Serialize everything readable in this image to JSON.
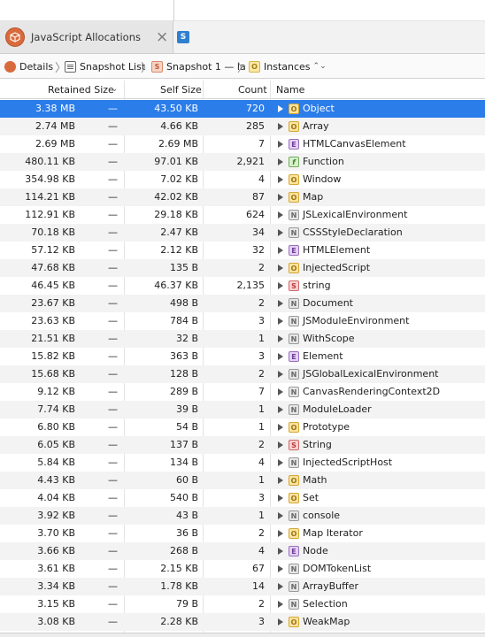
{
  "tab": {
    "title": "JavaScript Allocations",
    "close": "×",
    "secondary_badge": "S"
  },
  "breadcrumbs": [
    {
      "label": "Details"
    },
    {
      "label": "Snapshot List"
    },
    {
      "label": "Snapshot 1 — la",
      "badge": "S"
    },
    {
      "label": "Instances",
      "badge": "O",
      "chevron": "⌃⌄"
    }
  ],
  "columns": {
    "retained": "Retained Size",
    "self": "Self Size",
    "count": "Count",
    "name": "Name"
  },
  "rows": [
    {
      "retained": "3.38 MB",
      "self": "43.50 KB",
      "count": "720",
      "type": "O",
      "name": "Object",
      "selected": true
    },
    {
      "retained": "2.74 MB",
      "self": "4.66 KB",
      "count": "285",
      "type": "O",
      "name": "Array"
    },
    {
      "retained": "2.69 MB",
      "self": "2.69 MB",
      "count": "7",
      "type": "E",
      "name": "HTMLCanvasElement"
    },
    {
      "retained": "480.11 KB",
      "self": "97.01 KB",
      "count": "2,921",
      "type": "f",
      "name": "Function"
    },
    {
      "retained": "354.98 KB",
      "self": "7.02 KB",
      "count": "4",
      "type": "O",
      "name": "Window"
    },
    {
      "retained": "114.21 KB",
      "self": "42.02 KB",
      "count": "87",
      "type": "O",
      "name": "Map"
    },
    {
      "retained": "112.91 KB",
      "self": "29.18 KB",
      "count": "624",
      "type": "N",
      "name": "JSLexicalEnvironment"
    },
    {
      "retained": "70.18 KB",
      "self": "2.47 KB",
      "count": "34",
      "type": "N",
      "name": "CSSStyleDeclaration"
    },
    {
      "retained": "57.12 KB",
      "self": "2.12 KB",
      "count": "32",
      "type": "E",
      "name": "HTMLElement"
    },
    {
      "retained": "47.68 KB",
      "self": "135 B",
      "count": "2",
      "type": "O",
      "name": "InjectedScript"
    },
    {
      "retained": "46.45 KB",
      "self": "46.37 KB",
      "count": "2,135",
      "type": "S",
      "name": "string"
    },
    {
      "retained": "23.67 KB",
      "self": "498 B",
      "count": "2",
      "type": "N",
      "name": "Document"
    },
    {
      "retained": "23.63 KB",
      "self": "784 B",
      "count": "3",
      "type": "N",
      "name": "JSModuleEnvironment"
    },
    {
      "retained": "21.51 KB",
      "self": "32 B",
      "count": "1",
      "type": "N",
      "name": "WithScope"
    },
    {
      "retained": "15.82 KB",
      "self": "363 B",
      "count": "3",
      "type": "E",
      "name": "Element"
    },
    {
      "retained": "15.68 KB",
      "self": "128 B",
      "count": "2",
      "type": "N",
      "name": "JSGlobalLexicalEnvironment"
    },
    {
      "retained": "9.12 KB",
      "self": "289 B",
      "count": "7",
      "type": "N",
      "name": "CanvasRenderingContext2D"
    },
    {
      "retained": "7.74 KB",
      "self": "39 B",
      "count": "1",
      "type": "N",
      "name": "ModuleLoader"
    },
    {
      "retained": "6.80 KB",
      "self": "54 B",
      "count": "1",
      "type": "O",
      "name": "Prototype"
    },
    {
      "retained": "6.05 KB",
      "self": "137 B",
      "count": "2",
      "type": "S",
      "name": "String"
    },
    {
      "retained": "5.84 KB",
      "self": "134 B",
      "count": "4",
      "type": "N",
      "name": "InjectedScriptHost"
    },
    {
      "retained": "4.43 KB",
      "self": "60 B",
      "count": "1",
      "type": "O",
      "name": "Math"
    },
    {
      "retained": "4.04 KB",
      "self": "540 B",
      "count": "3",
      "type": "O",
      "name": "Set"
    },
    {
      "retained": "3.92 KB",
      "self": "43 B",
      "count": "1",
      "type": "N",
      "name": "console"
    },
    {
      "retained": "3.70 KB",
      "self": "36 B",
      "count": "2",
      "type": "O",
      "name": "Map Iterator"
    },
    {
      "retained": "3.66 KB",
      "self": "268 B",
      "count": "4",
      "type": "E",
      "name": "Node"
    },
    {
      "retained": "3.61 KB",
      "self": "2.15 KB",
      "count": "67",
      "type": "N",
      "name": "DOMTokenList"
    },
    {
      "retained": "3.34 KB",
      "self": "1.78 KB",
      "count": "14",
      "type": "N",
      "name": "ArrayBuffer"
    },
    {
      "retained": "3.15 KB",
      "self": "79 B",
      "count": "2",
      "type": "N",
      "name": "Selection"
    },
    {
      "retained": "3.08 KB",
      "self": "2.28 KB",
      "count": "3",
      "type": "O",
      "name": "WeakMap"
    }
  ],
  "dash": "—",
  "sort_indicator": "⌄",
  "colors": {
    "selection": "#2b7de9",
    "tab_icon": "#d96a3b"
  }
}
